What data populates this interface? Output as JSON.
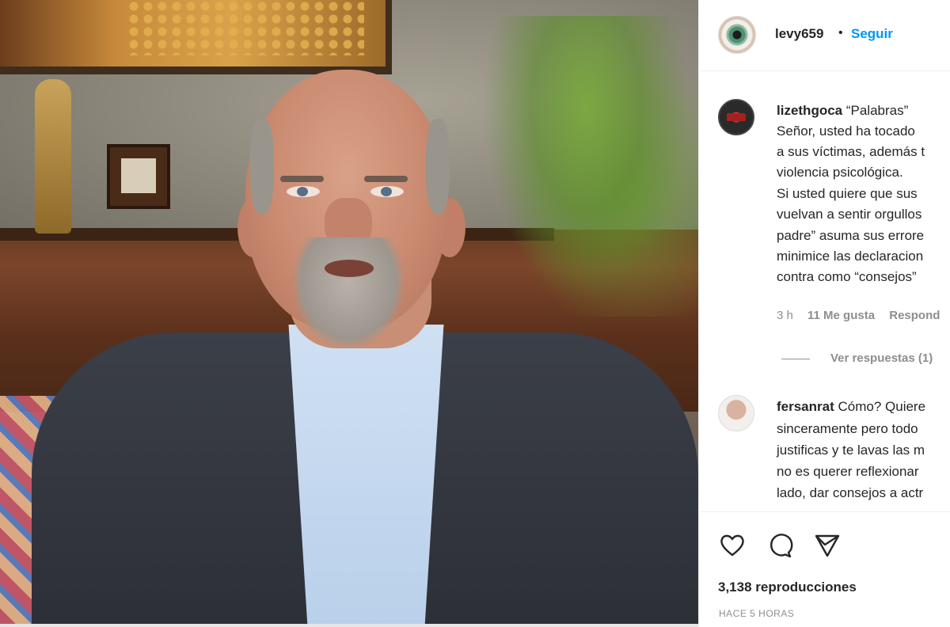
{
  "post": {
    "username": "levy659",
    "separator": "•",
    "follow_label": "Seguir"
  },
  "comments": [
    {
      "username": "lizethgoca",
      "lines": [
        "“Palabras”",
        "Señor, usted ha tocado",
        "a sus víctimas, además t",
        "violencia psicológica.",
        "Si usted quiere que sus",
        "vuelvan a sentir orgullos",
        "padre” asuma sus errore",
        "minimice las declaracion",
        "contra como “consejos”"
      ],
      "time": "3 h",
      "likes": "11 Me gusta",
      "reply_label": "Respond",
      "view_replies_label": "Ver respuestas (1)"
    },
    {
      "username": "fersanrat",
      "lines": [
        "Cómo? Quiere",
        "sinceramente pero todo",
        "justificas y te lavas las m",
        "no es querer reflexionar",
        "lado, dar consejos a actr"
      ]
    }
  ],
  "stats": {
    "views": "3,138 reproducciones",
    "time_ago": "HACE 5 HORAS"
  },
  "icons": [
    "heart-icon",
    "comment-icon",
    "share-icon"
  ]
}
